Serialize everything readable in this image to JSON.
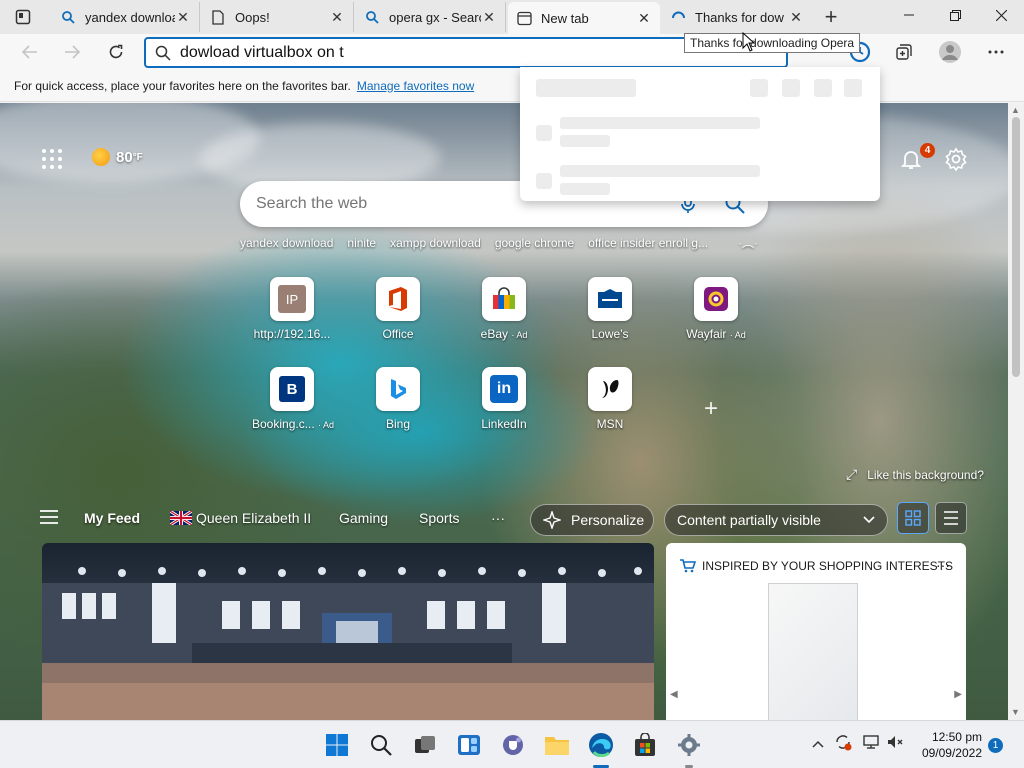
{
  "tabs": [
    {
      "label": "yandex downloa",
      "icon": "search-icon"
    },
    {
      "label": "Oops!",
      "icon": "page-icon"
    },
    {
      "label": "opera gx - Searc",
      "icon": "search-icon"
    },
    {
      "label": "New tab",
      "icon": "newtab-icon",
      "active": true
    },
    {
      "label": "Thanks for dow",
      "icon": "loading-icon"
    }
  ],
  "address_bar": {
    "value": "dowload virtualbox on t"
  },
  "tooltip": "Thanks for downloading Opera",
  "favorites_bar": {
    "text": "For quick access, place your favorites here on the favorites bar.",
    "link": "Manage favorites now"
  },
  "weather": {
    "temp": "80",
    "unit": "°F"
  },
  "notifications": {
    "count": "4"
  },
  "search": {
    "placeholder": "Search the web"
  },
  "quick_searches": [
    "yandex download",
    "ninite",
    "xampp download",
    "google chrome",
    "office insider enroll g..."
  ],
  "tiles": [
    {
      "label": "http://192.16...",
      "ad": "",
      "icon": "ip-icon"
    },
    {
      "label": "Office",
      "ad": "",
      "icon": "office-icon"
    },
    {
      "label": "eBay",
      "ad": "· Ad",
      "icon": "ebay-icon"
    },
    {
      "label": "Lowe's",
      "ad": "",
      "icon": "lowes-icon"
    },
    {
      "label": "Wayfair",
      "ad": "· Ad",
      "icon": "wayfair-icon"
    },
    {
      "label": "Booking.c...",
      "ad": "· Ad",
      "icon": "booking-icon"
    },
    {
      "label": "Bing",
      "ad": "",
      "icon": "bing-icon"
    },
    {
      "label": "LinkedIn",
      "ad": "",
      "icon": "linkedin-icon"
    },
    {
      "label": "MSN",
      "ad": "",
      "icon": "msn-icon"
    }
  ],
  "like_background": "Like this background?",
  "feed_nav": {
    "items": [
      "My Feed",
      "Queen Elizabeth II",
      "Gaming",
      "Sports"
    ],
    "more": "···",
    "personalize": "Personalize",
    "content_visibility": "Content partially visible"
  },
  "shopping_card": {
    "title": "INSPIRED BY YOUR SHOPPING INTERESTS",
    "more": "···"
  },
  "taskbar": {
    "time": "12:50 pm",
    "date": "09/09/2022",
    "notification_count": "1"
  },
  "colors": {
    "accent": "#0f6cbd",
    "badge": "#d83b01"
  }
}
